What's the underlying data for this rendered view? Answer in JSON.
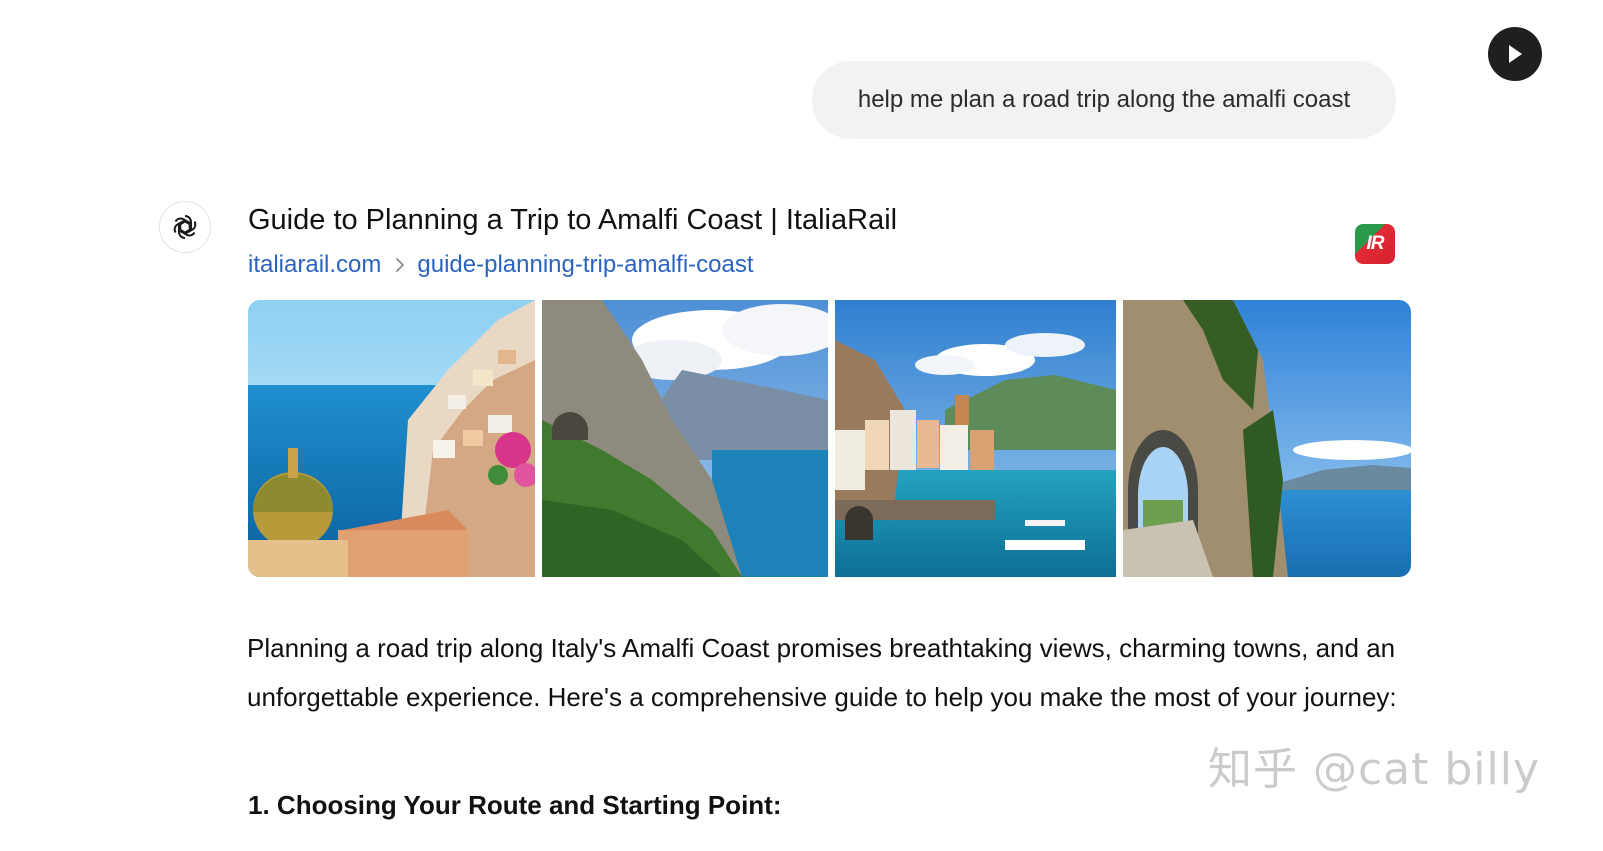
{
  "header": {
    "play_icon": "play-icon"
  },
  "user_message": {
    "text": "help me plan a road trip along the amalfi coast"
  },
  "assistant": {
    "avatar_icon": "openai-logo-icon",
    "source": {
      "title": "Guide to Planning a Trip to Amalfi Coast | ItaliaRail",
      "domain": "italiarail.com",
      "path": "guide-planning-trip-amalfi-coast",
      "separator_icon": "chevron-right-icon",
      "logo_text": "IR"
    },
    "images": [
      {
        "icon": "positano-photo"
      },
      {
        "icon": "cliffs-coast-photo"
      },
      {
        "icon": "atrani-village-photo"
      },
      {
        "icon": "rock-tunnel-road-photo"
      }
    ],
    "intro": "Planning a road trip along Italy's Amalfi Coast promises breathtaking views, charming towns, and an unforgettable experience. Here's a comprehensive guide to help you make the most of your journey:",
    "section_number": "1.",
    "section_title": "Choosing Your Route and Starting Point:"
  },
  "watermark": {
    "text": "知乎 @cat billy"
  },
  "colors": {
    "link": "#2b63c2",
    "bubble_bg": "#f2f2f2",
    "play_bg": "#1f1f1f"
  }
}
